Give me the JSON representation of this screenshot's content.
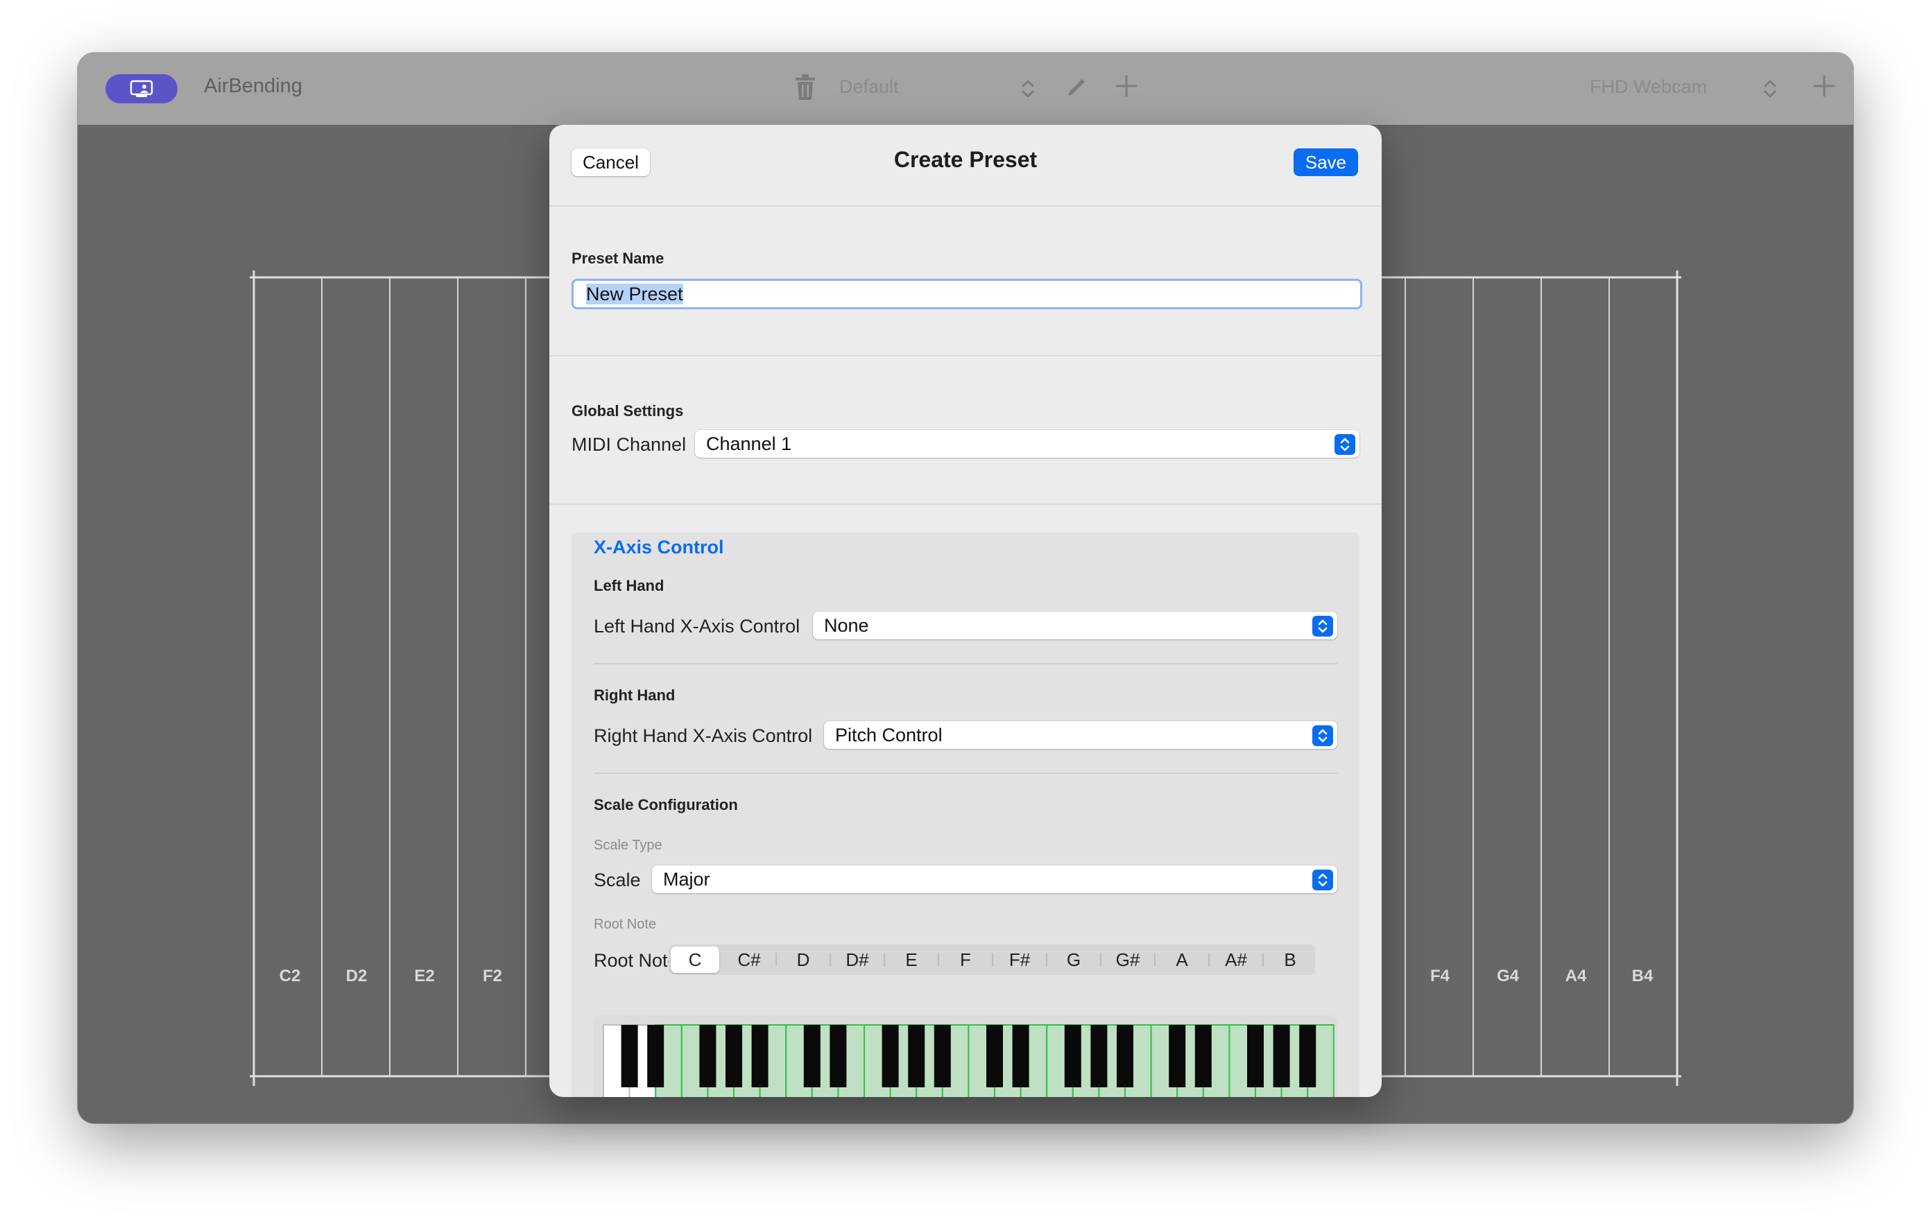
{
  "titlebar": {
    "app_name": "AirBending",
    "preset_value": "Default",
    "camera_value": "FHD Webcam"
  },
  "grid": {
    "left_notes": [
      "C2",
      "D2",
      "E2",
      "F2"
    ],
    "right_notes": [
      "F4",
      "G4",
      "A4",
      "B4"
    ]
  },
  "sheet": {
    "cancel_label": "Cancel",
    "title": "Create Preset",
    "save_label": "Save",
    "preset_name_label": "Preset Name",
    "preset_name_value": "New Preset",
    "global_settings_label": "Global Settings",
    "midi_channel_label": "MIDI Channel",
    "midi_channel_value": "Channel 1",
    "xaxis": {
      "title": "X-Axis Control",
      "left_hand_label": "Left Hand",
      "left_control_label": "Left Hand X-Axis Control",
      "left_control_value": "None",
      "right_hand_label": "Right Hand",
      "right_control_label": "Right Hand X-Axis Control",
      "right_control_value": "Pitch Control",
      "scale_config_label": "Scale Configuration",
      "scale_type_label": "Scale Type",
      "scale_label": "Scale",
      "scale_value": "Major",
      "root_note_caption": "Root Note",
      "root_note_label": "Root Note",
      "root_notes": [
        "C",
        "C#",
        "D",
        "D#",
        "E",
        "F",
        "F#",
        "G",
        "G#",
        "A",
        "A#",
        "B"
      ],
      "selected_root": "C"
    }
  },
  "colors": {
    "accent": "#0a6cf0",
    "app_button": "#5a54c8",
    "scale_key_highlight": "#bfe0c2"
  },
  "icons": [
    "screen-person-icon",
    "trash-icon",
    "up-down-chevron-icon",
    "pencil-icon",
    "plus-icon"
  ]
}
